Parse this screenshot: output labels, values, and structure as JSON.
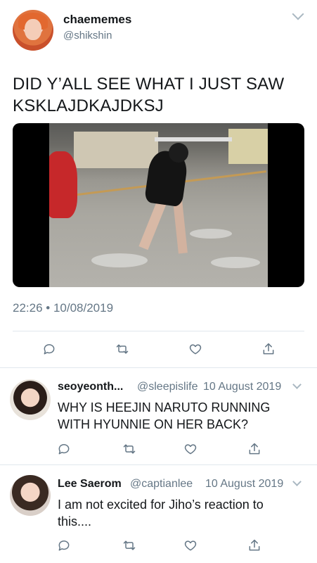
{
  "main_tweet": {
    "display_name": "chaememes",
    "handle": "@shikshin",
    "text_line1": "DID Y’ALL SEE WHAT I JUST SAW",
    "text_line2": "KSKLAJDKAJDKSJ",
    "timestamp": "22:26 • 10/08/2019",
    "avatar_icon": "profile-photo",
    "media_icon": "video-thumbnail"
  },
  "replies": [
    {
      "display_name": "seoyeonth...",
      "handle": "@sleepislife",
      "date": "10 August 2019",
      "text_line1": "WHY IS HEEJIN NARUTO RUNNING",
      "text_line2": "WITH HYUNNIE ON HER BACK?"
    },
    {
      "display_name": "Lee Saerom",
      "handle": "@captianlee",
      "date": "10 August 2019",
      "text_line1": "I am not excited for Jiho’s reaction to",
      "text_line2": "this...."
    }
  ],
  "actions": [
    "reply-icon",
    "retweet-icon",
    "like-icon",
    "share-icon"
  ],
  "colors": {
    "primary_text": "#14171a",
    "secondary_text": "#657786",
    "divider": "#e1e8ed"
  }
}
